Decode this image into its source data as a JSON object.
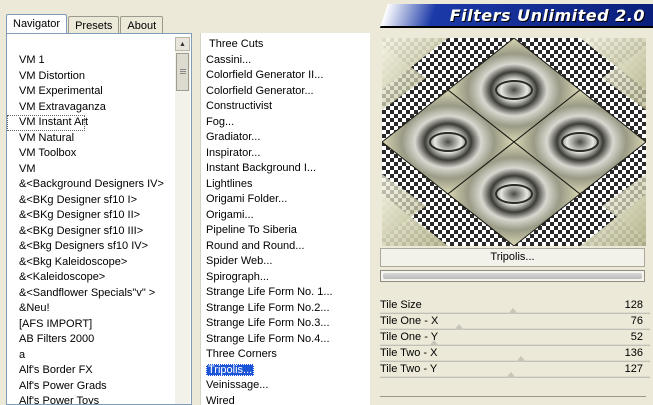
{
  "window": {
    "title": "Filters Unlimited 2.0"
  },
  "tabs": [
    {
      "label": "Navigator",
      "active": true
    },
    {
      "label": "Presets",
      "active": false
    },
    {
      "label": "About",
      "active": false
    }
  ],
  "categories": [
    "VM 1",
    "VM Distortion",
    "VM Experimental",
    "VM Extravaganza",
    "VM Instant Art",
    "VM Natural",
    "VM Toolbox",
    "VM",
    "&<Background Designers IV>",
    "&<BKg Designer sf10 I>",
    "&<BKg Designer sf10 II>",
    "&<BKg Designer sf10 III>",
    "&<Bkg Designers sf10 IV>",
    "&<Bkg Kaleidoscope>",
    "&<Kaleidoscope>",
    "&<Sandflower Specials\"v\" >",
    "&Neu!",
    "[AFS IMPORT]",
    "AB Filters 2000",
    "a",
    "Alf's Border FX",
    "Alf's Power Grads",
    "Alf's Power Toys"
  ],
  "selected_category": "VM Instant Art",
  "filters": [
    "Three Cuts",
    "Cassini...",
    "Colorfield Generator II...",
    "Colorfield Generator...",
    "Constructivist",
    "Fog...",
    "Gradiator...",
    "Inspirator...",
    "Instant Background I...",
    "Lightlines",
    "Origami Folder...",
    "Origami...",
    "Pipeline To Siberia",
    "Round and Round...",
    "Spider Web...",
    "Spirograph...",
    "Strange Life Form No. 1...",
    "Strange Life Form No.2...",
    "Strange Life Form No.3...",
    "Strange Life Form No.4...",
    "Three Corners",
    "Tripolis...",
    "Veinissage...",
    "Wired"
  ],
  "selected_filter": "Tripolis...",
  "filter_name_button": "Tripolis...",
  "sliders": [
    {
      "label": "Tile Size",
      "value": "128",
      "fraction": 0.502
    },
    {
      "label": "Tile One - X",
      "value": "76",
      "fraction": 0.298
    },
    {
      "label": "Tile One - Y",
      "value": "52",
      "fraction": 0.204
    },
    {
      "label": "Tile Two - X",
      "value": "136",
      "fraction": 0.533
    },
    {
      "label": "Tile Two - Y",
      "value": "127",
      "fraction": 0.498
    }
  ],
  "colors": {
    "banner": "#0a1e7a",
    "selection": "#1c54d8",
    "preview_tint": "#c9c8a0"
  }
}
